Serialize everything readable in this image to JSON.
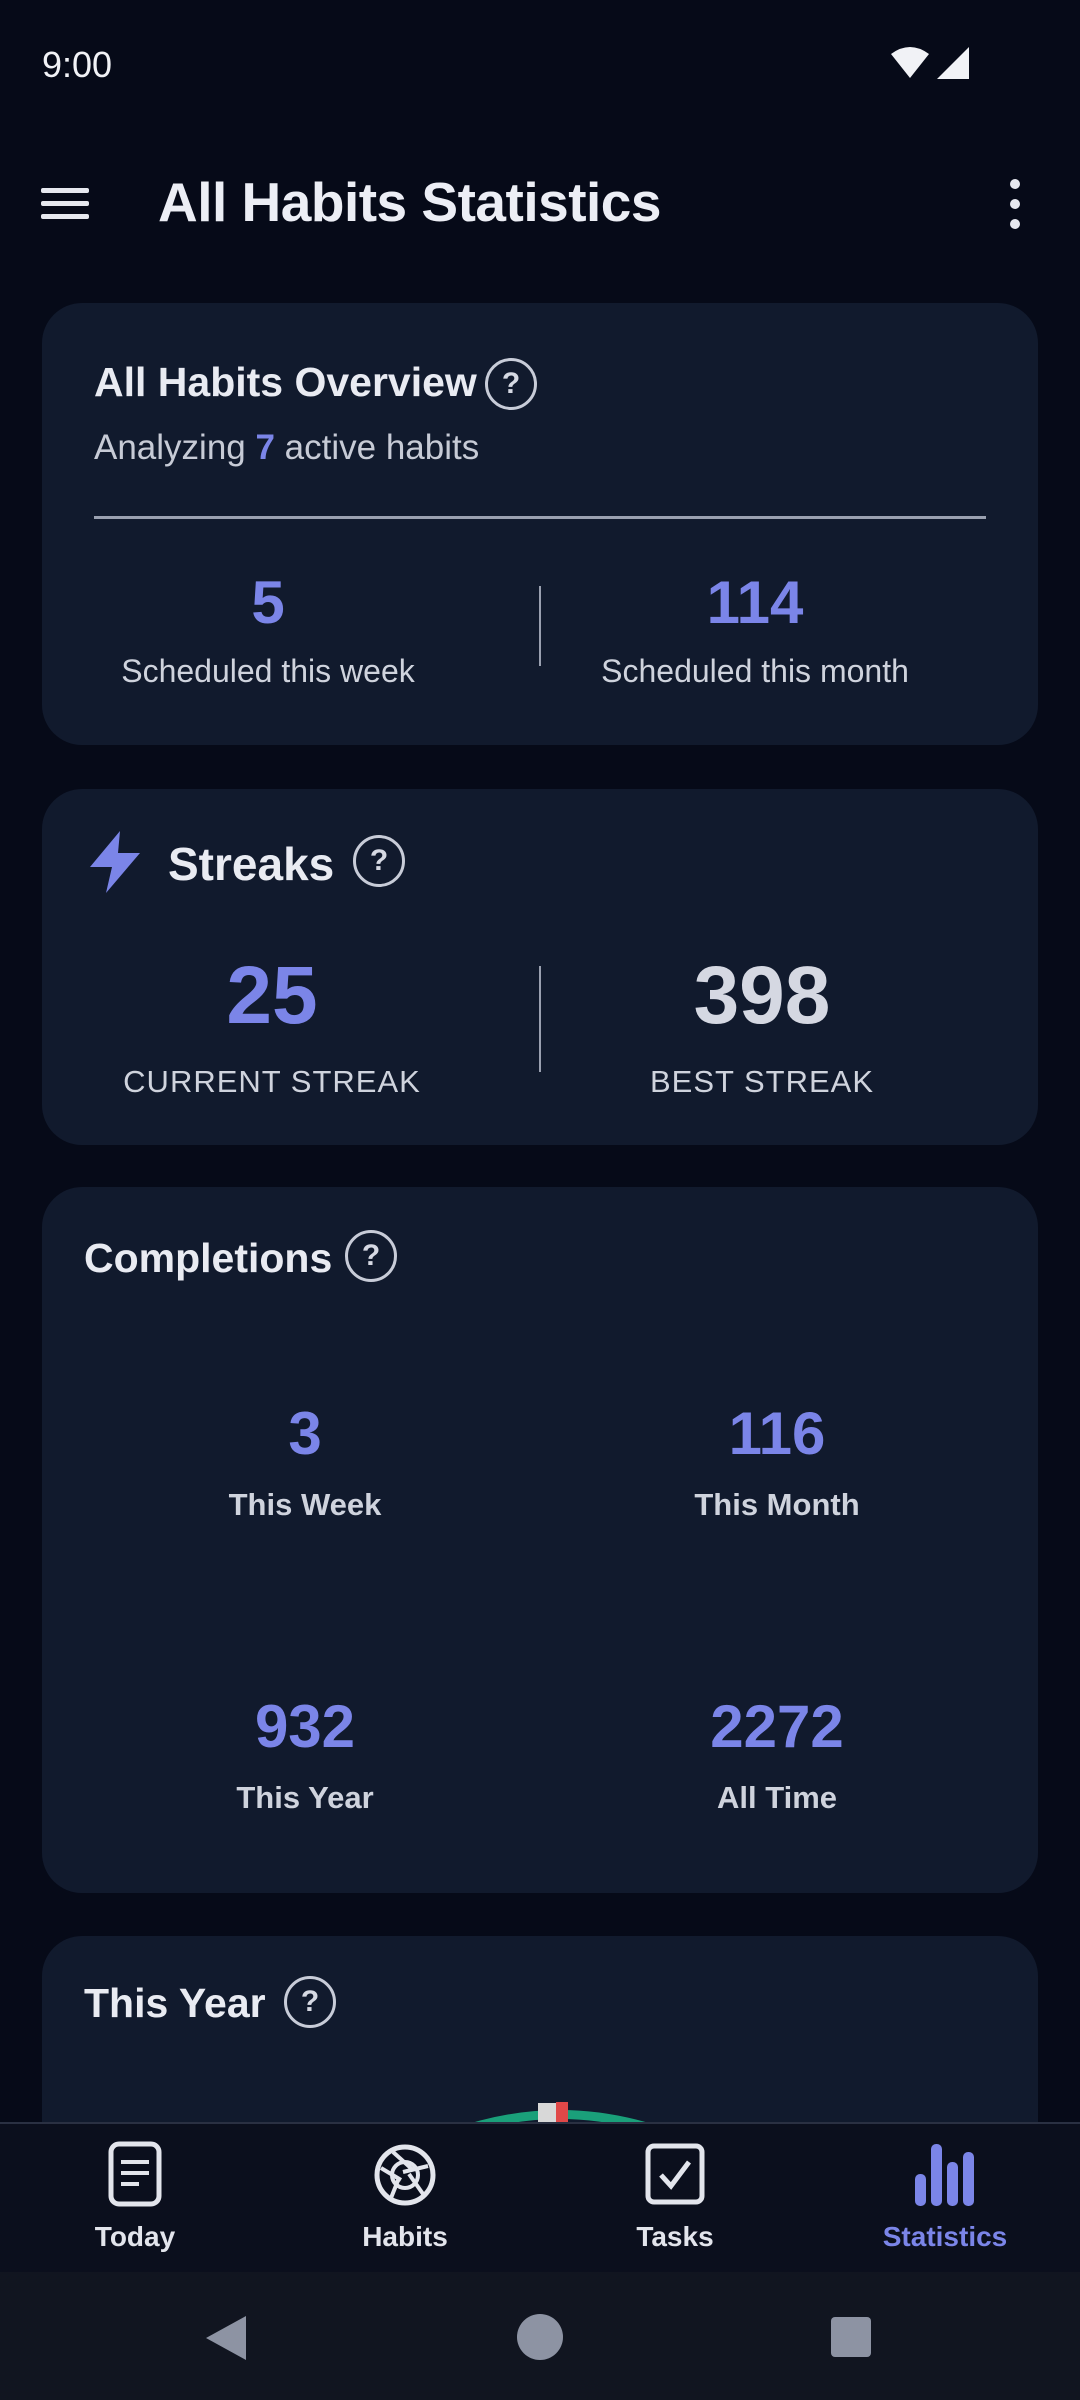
{
  "status_bar": {
    "time": "9:00"
  },
  "app_bar": {
    "title": "All Habits Statistics"
  },
  "overview": {
    "title": "All Habits Overview",
    "help": "?",
    "subtitle_prefix": "Analyzing ",
    "active_count": "7",
    "subtitle_suffix": " active habits",
    "scheduled_week_value": "5",
    "scheduled_week_label": "Scheduled this week",
    "scheduled_month_value": "114",
    "scheduled_month_label": "Scheduled this month"
  },
  "streaks": {
    "title": "Streaks",
    "help": "?",
    "current_value": "25",
    "current_label": "CURRENT STREAK",
    "best_value": "398",
    "best_label": "BEST STREAK"
  },
  "completions": {
    "title": "Completions",
    "help": "?",
    "week_value": "3",
    "week_label": "This Week",
    "month_value": "116",
    "month_label": "This Month",
    "year_value": "932",
    "year_label": "This Year",
    "all_value": "2272",
    "all_label": "All Time"
  },
  "this_year": {
    "title": "This Year",
    "help": "?"
  },
  "bottom_nav": {
    "items": [
      {
        "label": "Today",
        "icon": "document-icon"
      },
      {
        "label": "Habits",
        "icon": "aperture-icon"
      },
      {
        "label": "Tasks",
        "icon": "checkbox-icon"
      },
      {
        "label": "Statistics",
        "icon": "bar-chart-icon",
        "active": true
      }
    ]
  },
  "colors": {
    "accent": "#7b85e8",
    "background": "#060a18",
    "card": "#111a2d"
  }
}
